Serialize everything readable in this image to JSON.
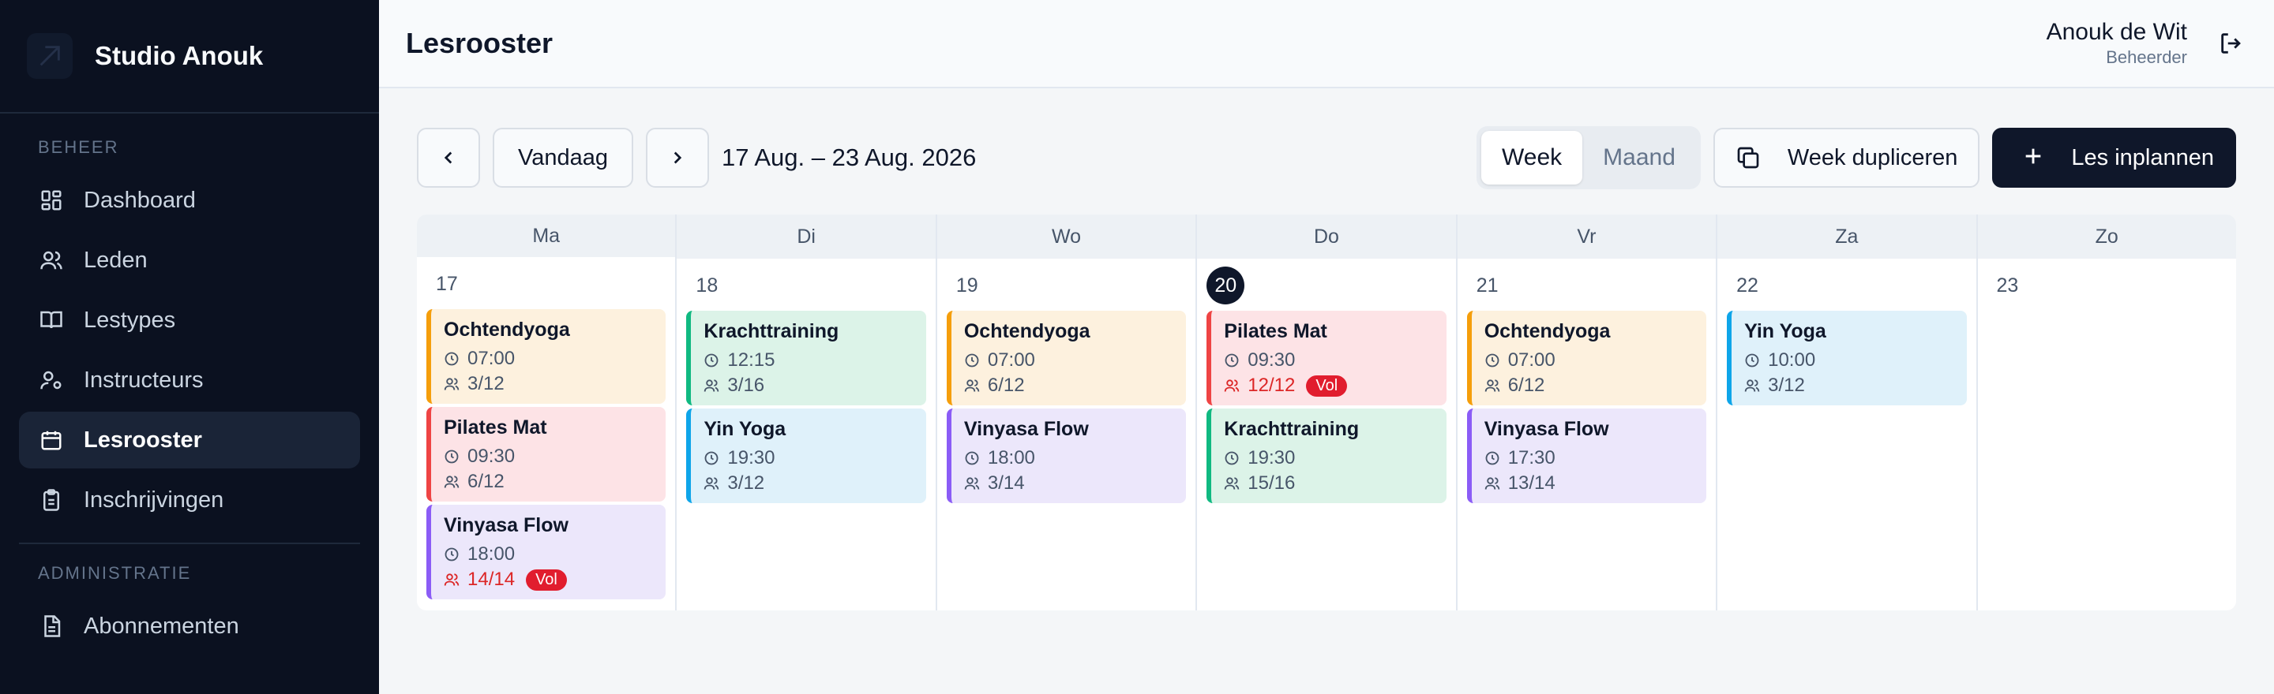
{
  "sidebar": {
    "brand": "Studio Anouk",
    "section1": "BEHEER",
    "items": [
      {
        "label": "Dashboard",
        "icon": "dashboard-icon"
      },
      {
        "label": "Leden",
        "icon": "users-icon"
      },
      {
        "label": "Lestypes",
        "icon": "book-icon"
      },
      {
        "label": "Instructeurs",
        "icon": "instructor-icon"
      },
      {
        "label": "Lesrooster",
        "icon": "calendar-icon",
        "active": true
      },
      {
        "label": "Inschrijvingen",
        "icon": "clipboard-icon"
      }
    ],
    "section2": "ADMINISTRATIE",
    "items2": [
      {
        "label": "Abonnementen",
        "icon": "document-icon"
      }
    ]
  },
  "header": {
    "title": "Lesrooster",
    "user_name": "Anouk de Wit",
    "user_role": "Beheerder"
  },
  "toolbar": {
    "prev": "‹",
    "today": "Vandaag",
    "next": "›",
    "range": "17 Aug. – 23 Aug. 2026",
    "view_week": "Week",
    "view_month": "Maand",
    "duplicate": "Week dupliceren",
    "add": "Les inplannen"
  },
  "colors": {
    "orange": "#f59e0b",
    "red": "#ef4444",
    "purple": "#8b5cf6",
    "green": "#10b981",
    "blue": "#0ea5e9",
    "sidebar_bg": "#0b1120",
    "primary": "#0f172a"
  },
  "days": [
    {
      "head": "Ma",
      "num": "17",
      "events": [
        {
          "title": "Ochtendyoga",
          "time": "07:00",
          "count": "3/12",
          "color": "orange"
        },
        {
          "title": "Pilates Mat",
          "time": "09:30",
          "count": "6/12",
          "color": "red"
        },
        {
          "title": "Vinyasa Flow",
          "time": "18:00",
          "count": "14/14",
          "color": "purple",
          "badge": "Vol"
        }
      ]
    },
    {
      "head": "Di",
      "num": "18",
      "events": [
        {
          "title": "Krachttraining",
          "time": "12:15",
          "count": "3/16",
          "color": "green"
        },
        {
          "title": "Yin Yoga",
          "time": "19:30",
          "count": "3/12",
          "color": "blue"
        }
      ]
    },
    {
      "head": "Wo",
      "num": "19",
      "events": [
        {
          "title": "Ochtendyoga",
          "time": "07:00",
          "count": "6/12",
          "color": "orange"
        },
        {
          "title": "Vinyasa Flow",
          "time": "18:00",
          "count": "3/14",
          "color": "purple"
        }
      ]
    },
    {
      "head": "Do",
      "num": "20",
      "today": true,
      "events": [
        {
          "title": "Pilates Mat",
          "time": "09:30",
          "count": "12/12",
          "color": "red",
          "badge": "Vol"
        },
        {
          "title": "Krachttraining",
          "time": "19:30",
          "count": "15/16",
          "color": "green"
        }
      ]
    },
    {
      "head": "Vr",
      "num": "21",
      "events": [
        {
          "title": "Ochtendyoga",
          "time": "07:00",
          "count": "6/12",
          "color": "orange"
        },
        {
          "title": "Vinyasa Flow",
          "time": "17:30",
          "count": "13/14",
          "color": "purple"
        }
      ]
    },
    {
      "head": "Za",
      "num": "22",
      "events": [
        {
          "title": "Yin Yoga",
          "time": "10:00",
          "count": "3/12",
          "color": "blue"
        }
      ]
    },
    {
      "head": "Zo",
      "num": "23",
      "events": []
    }
  ]
}
